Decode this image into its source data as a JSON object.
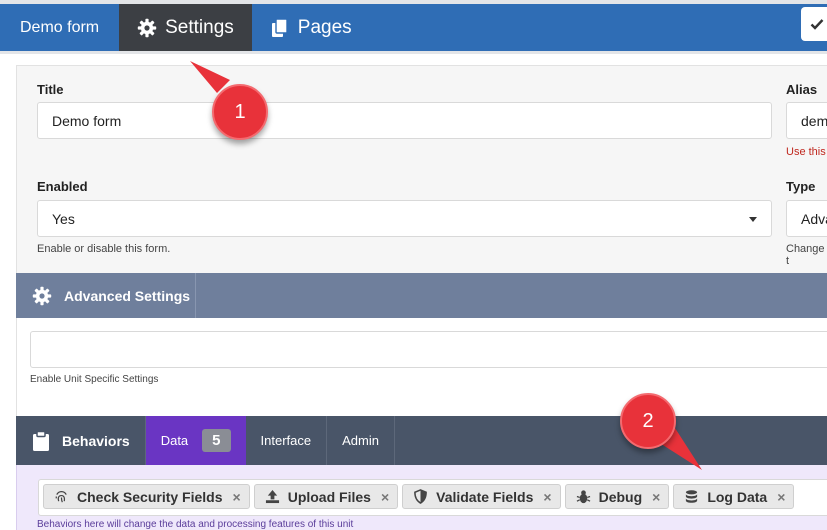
{
  "nav": {
    "tabs": [
      {
        "label": "Demo form",
        "icon": "none"
      },
      {
        "label": "Settings",
        "icon": "gear-icon"
      },
      {
        "label": "Pages",
        "icon": "pages-icon"
      }
    ],
    "active_tab": "Settings"
  },
  "form": {
    "title_label": "Title",
    "title_value": "Demo form",
    "alias_label": "Alias",
    "alias_value": "dem",
    "alias_help": "Use this",
    "enabled_label": "Enabled",
    "enabled_value": "Yes",
    "enabled_help": "Enable or disable this form.",
    "type_label": "Type",
    "type_value": "Adva",
    "type_help": "Change t"
  },
  "advanced": {
    "title": "Advanced Settings",
    "help": "Enable Unit Specific Settings"
  },
  "behaviors": {
    "title": "Behaviors",
    "tabs": [
      {
        "label": "Data",
        "count": "5"
      },
      {
        "label": "Interface"
      },
      {
        "label": "Admin"
      }
    ],
    "chips": [
      {
        "label": "Check Security Fields",
        "icon": "fingerprint-icon"
      },
      {
        "label": "Upload Files",
        "icon": "upload-icon"
      },
      {
        "label": "Validate Fields",
        "icon": "shield-icon"
      },
      {
        "label": "Debug",
        "icon": "bug-icon"
      },
      {
        "label": "Log Data",
        "icon": "database-icon"
      }
    ],
    "help": "Behaviors here will change the data and processing features of this unit"
  },
  "callouts": [
    "1",
    "2"
  ],
  "colors": {
    "nav_bg": "#2f6db5",
    "nav_active": "#3c3f44",
    "advanced_bar": "#6f7f9c",
    "behaviors_bar": "#495568",
    "behaviors_active": "#6a35c3",
    "callout": "#e8323a"
  }
}
